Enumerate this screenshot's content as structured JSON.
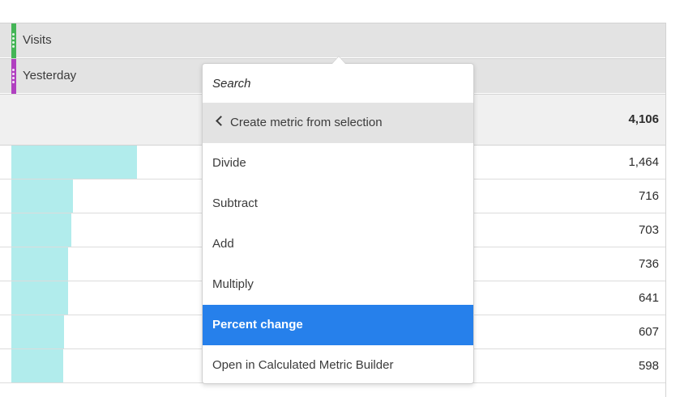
{
  "table": {
    "headers": [
      {
        "label": "Visits",
        "color": "#44b556"
      },
      {
        "label": "Yesterday",
        "color": "#b040c0"
      }
    ],
    "total": "4,106",
    "rows": [
      {
        "value": "1,464",
        "bar_fraction": 1.0
      },
      {
        "value": "716",
        "bar_fraction": 0.49
      },
      {
        "value": "703",
        "bar_fraction": 0.48
      },
      {
        "value": "736",
        "bar_fraction": 0.45
      },
      {
        "value": "641",
        "bar_fraction": 0.45
      },
      {
        "value": "607",
        "bar_fraction": 0.42
      },
      {
        "value": "598",
        "bar_fraction": 0.41
      }
    ],
    "bar_color": "#b1ecec"
  },
  "popover": {
    "search_placeholder": "Search",
    "back_label": "Create metric from selection",
    "items": [
      {
        "label": "Divide",
        "selected": false
      },
      {
        "label": "Subtract",
        "selected": false
      },
      {
        "label": "Add",
        "selected": false
      },
      {
        "label": "Multiply",
        "selected": false
      },
      {
        "label": "Percent change",
        "selected": true
      },
      {
        "label": "Open in Calculated Metric Builder",
        "selected": false
      }
    ],
    "accent_color": "#2680eb"
  }
}
